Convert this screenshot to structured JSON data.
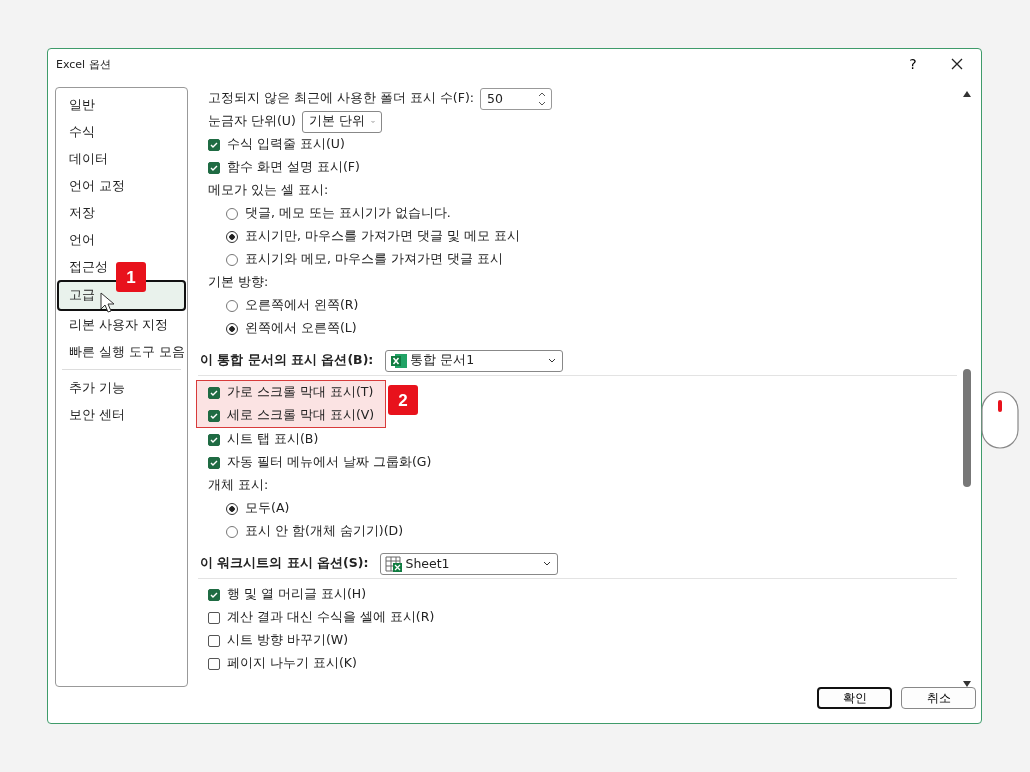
{
  "window": {
    "title": "Excel 옵션",
    "help": "?"
  },
  "sidebar": {
    "groups": [
      {
        "items": [
          {
            "label": "일반",
            "selected": false
          },
          {
            "label": "수식",
            "selected": false
          },
          {
            "label": "데이터",
            "selected": false
          },
          {
            "label": "언어 교정",
            "selected": false
          },
          {
            "label": "저장",
            "selected": false
          },
          {
            "label": "언어",
            "selected": false
          },
          {
            "label": "접근성",
            "selected": false
          },
          {
            "label": "고급",
            "selected": true,
            "badge": "1"
          },
          {
            "label": "리본 사용자 지정",
            "selected": false
          },
          {
            "label": "빠른 실행 도구 모음",
            "selected": false
          }
        ]
      },
      {
        "items": [
          {
            "label": "추가 기능",
            "selected": false
          },
          {
            "label": "보안 센터",
            "selected": false
          }
        ]
      }
    ]
  },
  "options": [
    {
      "kind": "number",
      "label": "고정되지 않은 최근에 사용한 폴더 표시 수(F):",
      "value": "50"
    },
    {
      "kind": "dropdown",
      "label": "눈금자 단위(U)",
      "value": "기본 단위"
    },
    {
      "kind": "checkbox",
      "label": "수식 입력줄 표시(U)",
      "checked": true
    },
    {
      "kind": "checkbox",
      "label": "함수 화면 설명 표시(F)",
      "checked": true
    },
    {
      "kind": "label",
      "label": "메모가 있는 셀 표시:"
    },
    {
      "kind": "radio",
      "label": "댓글, 메모 또는 표시기가 없습니다.",
      "selected": false
    },
    {
      "kind": "radio",
      "label": "표시기만, 마우스를 가져가면 댓글 및 메모 표시",
      "selected": true
    },
    {
      "kind": "radio",
      "label": "표시기와 메모, 마우스를 가져가면 댓글 표시",
      "selected": false
    },
    {
      "kind": "label",
      "label": "기본 방향:"
    },
    {
      "kind": "radio",
      "label": "오른쪽에서 왼쪽(R)",
      "selected": false
    },
    {
      "kind": "radio",
      "label": "왼쪽에서 오른쪽(L)",
      "selected": true
    },
    {
      "kind": "section",
      "label": "이 통합 문서의 표시 옵션(B):",
      "value": "통합 문서1"
    },
    {
      "kind": "callout",
      "badge": "2",
      "children": [
        {
          "label": "가로 스크롤 막대 표시(T)",
          "checked": true
        },
        {
          "label": "세로 스크롤 막대 표시(V)",
          "checked": true
        }
      ]
    },
    {
      "kind": "checkbox",
      "label": "시트 탭 표시(B)",
      "checked": true
    },
    {
      "kind": "checkbox",
      "label": "자동 필터 메뉴에서 날짜 그룹화(G)",
      "checked": true
    },
    {
      "kind": "label",
      "label": "개체 표시:"
    },
    {
      "kind": "radio",
      "label": "모두(A)",
      "selected": true
    },
    {
      "kind": "radio",
      "label": "표시 안 함(개체 숨기기)(D)",
      "selected": false
    },
    {
      "kind": "section",
      "label": "이 워크시트의 표시 옵션(S):",
      "value": "Sheet1"
    },
    {
      "kind": "checkbox",
      "label": "행 및 열 머리글 표시(H)",
      "checked": true
    },
    {
      "kind": "checkbox",
      "label": "계산 결과 대신 수식을 셀에 표시(R)",
      "checked": false
    },
    {
      "kind": "checkbox",
      "label": "시트 방향 바꾸기(W)",
      "checked": false
    },
    {
      "kind": "checkbox",
      "label": "페이지 나누기 표시(K)",
      "checked": false
    }
  ],
  "buttons": [
    "확인",
    "취소"
  ]
}
